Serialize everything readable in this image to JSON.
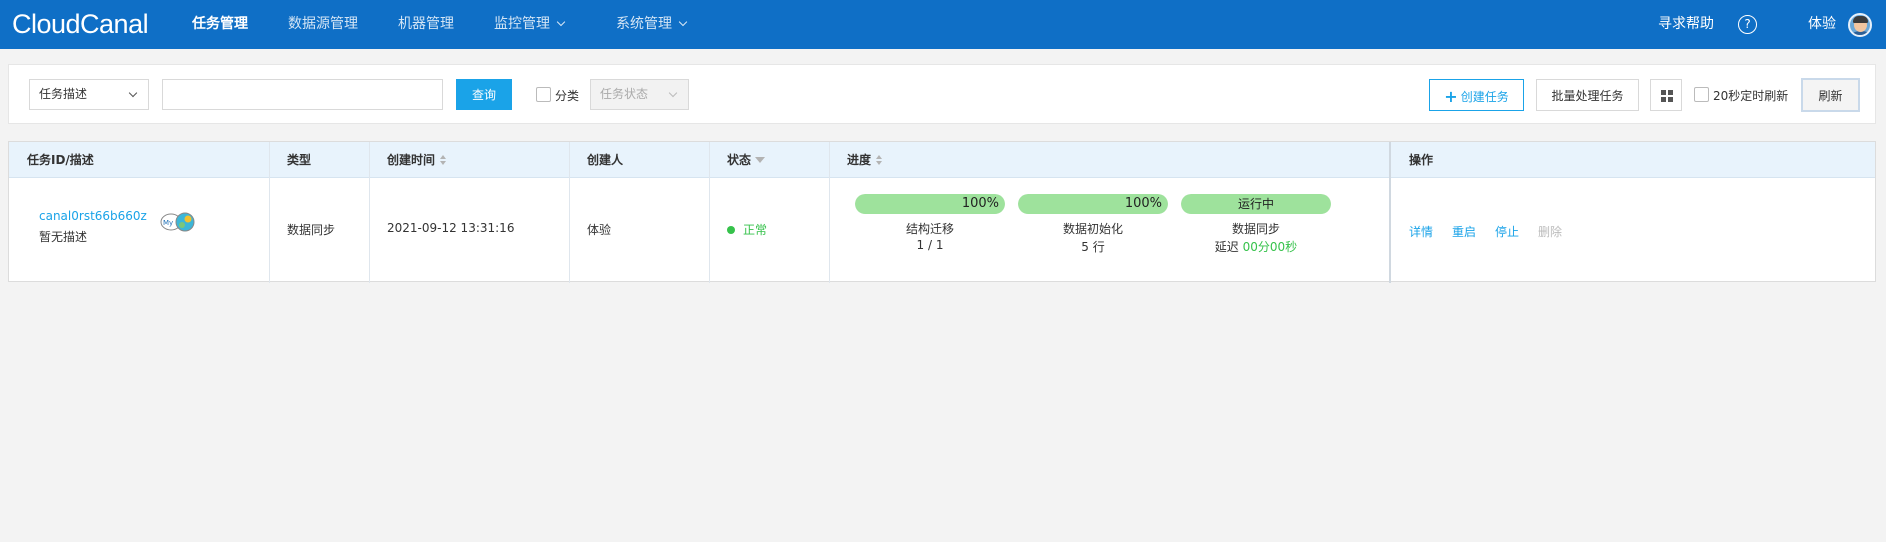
{
  "nav": {
    "logo": "CloudCanal",
    "items": [
      "任务管理",
      "数据源管理",
      "机器管理",
      "监控管理",
      "系统管理"
    ],
    "help": "寻求帮助",
    "help_icon": "?",
    "user": "体验"
  },
  "filter": {
    "select_label": "任务描述",
    "search_value": "",
    "query_label": "查询",
    "category_label": "分类",
    "status_placeholder": "任务状态",
    "create_label": "创建任务",
    "batch_label": "批量处理任务",
    "auto_refresh_label": "20秒定时刷新",
    "refresh_label": "刷新"
  },
  "table": {
    "headers": [
      "任务ID/描述",
      "类型",
      "创建时间",
      "创建人",
      "状态",
      "进度",
      "操作"
    ],
    "row": {
      "task_id": "canal0rst66b660z",
      "desc": "暂无描述",
      "type": "数据同步",
      "created_at": "2021-09-12 13:31:16",
      "creator": "体验",
      "status": "正常",
      "progress": [
        {
          "pct": "100%",
          "value": 1.0,
          "stage": "结构迁移",
          "detail": "1 / 1"
        },
        {
          "pct": "100%",
          "value": 1.0,
          "stage": "数据初始化",
          "detail": "5 行"
        },
        {
          "label": "运行中",
          "value": 1.0,
          "stage": "数据同步",
          "delay_label": "延迟",
          "delay_value": "00分00秒"
        }
      ],
      "ops": [
        "详情",
        "重启",
        "停止",
        "删除"
      ]
    }
  },
  "colors": {
    "nav_bg": "#0f6fc6",
    "accent": "#1aa3e8",
    "progress": "#9ee29c",
    "status_ok": "#36c24b",
    "header_bg": "#e8f3fc"
  }
}
